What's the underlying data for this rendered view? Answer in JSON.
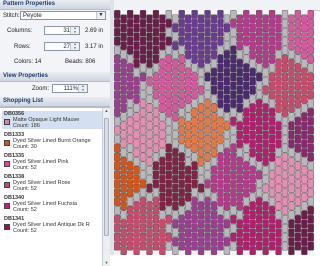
{
  "sections": {
    "pattern_properties": "Pattern Properties",
    "view_properties": "View Properties",
    "shopping_list": "Shopping List"
  },
  "pattern": {
    "stitch_label": "Stitch:",
    "stitch_value": "Peyote",
    "columns_label": "Columns:",
    "columns_value": "31",
    "columns_in": "2.69 in",
    "rows_label": "Rows:",
    "rows_value": "27",
    "rows_in": "3.17 in",
    "colors_text": "Colors: 14",
    "beads_text": "Beads: 806"
  },
  "view": {
    "zoom_label": "Zoom:",
    "zoom_value": "111%"
  },
  "shopping": [
    {
      "code": "DB0356",
      "name": "Matte Opaque Light Mauve",
      "count": "Count: 186",
      "color": "#c98aa6"
    },
    {
      "code": "DB1333",
      "name": "Dyed Silver Lined Burnt Orange",
      "count": "Count: 30",
      "color": "#d2551c"
    },
    {
      "code": "DB1335",
      "name": "Dyed Silver Lined Pink",
      "count": "Count: 52",
      "color": "#e0489a"
    },
    {
      "code": "DB1338",
      "name": "Dyed Silver Lined Rose",
      "count": "Count: 52",
      "color": "#c8466a"
    },
    {
      "code": "DB1340",
      "name": "Dyed Silver Lined Fuchsia",
      "count": "Count: 52",
      "color": "#c0207a"
    },
    {
      "code": "DB1341",
      "name": "Dyed Silver Lined Antique Dk R",
      "count": "Count: 52",
      "color": "#8a1e3a"
    }
  ],
  "colors": {
    "bead_palette": [
      "#6a1f4a",
      "#8a2a6e",
      "#b43b8c",
      "#d45a9e",
      "#c64b6d",
      "#e07a4a",
      "#d2551c",
      "#6b3b8f",
      "#4b2a6e",
      "#9a3e8f",
      "#e18fb3",
      "#b0206e",
      "#7e2546",
      "#c98aa6"
    ]
  }
}
